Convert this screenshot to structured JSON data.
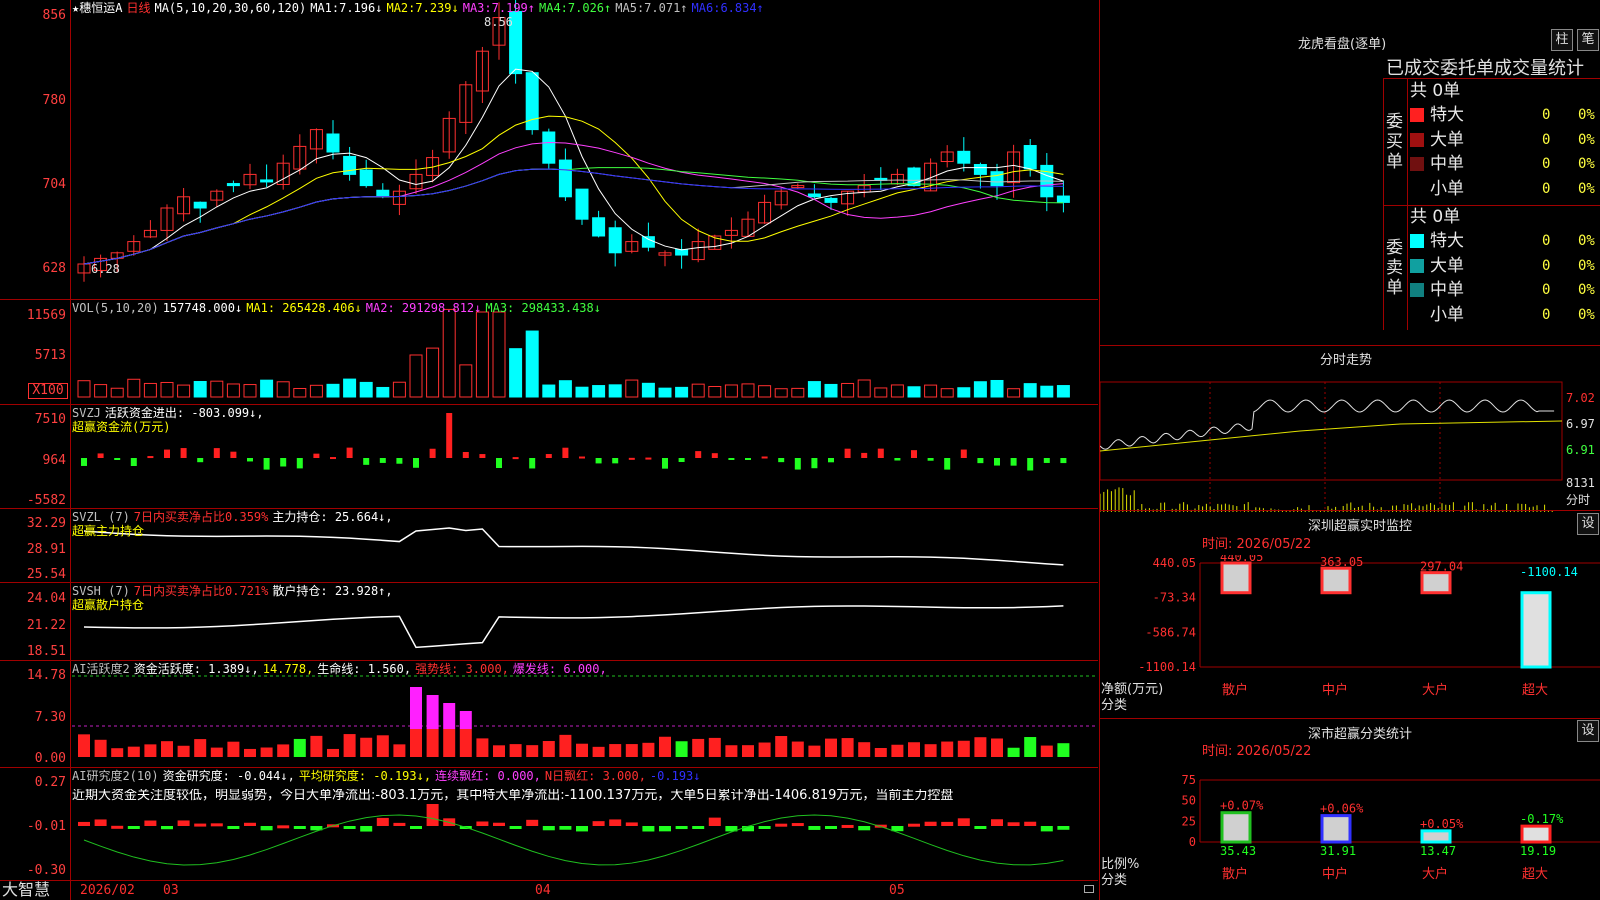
{
  "stock": {
    "star": "★",
    "name": "穗恒运A",
    "period": "日线",
    "ma_params": "MA(5,10,20,30,60,120)"
  },
  "ma_values": [
    {
      "label": "MA1:",
      "val": "7.196↓",
      "color": "#ffffff"
    },
    {
      "label": "MA2:",
      "val": "7.239↓",
      "color": "#ffff00"
    },
    {
      "label": "MA3:",
      "val": "7.199↑",
      "color": "#ff40ff"
    },
    {
      "label": "MA4:",
      "val": "7.026↑",
      "color": "#40ff40"
    },
    {
      "label": "MA5:",
      "val": "7.071↑",
      "color": "#c0c0c0"
    },
    {
      "label": "MA6:",
      "val": "6.834↑",
      "color": "#3030ff"
    }
  ],
  "price_axis": [
    "856",
    "780",
    "704",
    "628"
  ],
  "annotations": {
    "high": "8.56",
    "low": "6.28"
  },
  "vol": {
    "params": "VOL(5,10,20)",
    "value": "157748.000↓",
    "ma1": "MA1: 265428.406↓",
    "ma2": "MA2: 291298.812↓",
    "ma3": "MA3: 298433.438↓",
    "axis": [
      "11569",
      "5713"
    ],
    "unit": "X100"
  },
  "svzj": {
    "name": "SVZJ",
    "line1": "活跃资金进出: -803.099↓,",
    "line2": "超赢资金流(万元)",
    "axis": [
      "7510",
      "964",
      "-5582"
    ]
  },
  "svzl": {
    "name": "SVZL (7)",
    "ratio": "7日内买卖净占比0.359%",
    "hold": "主力持仓: 25.664↓,",
    "line2": "超赢主力持仓",
    "axis": [
      "32.29",
      "28.91",
      "25.54"
    ]
  },
  "svsh": {
    "name": "SVSH (7)",
    "ratio": "7日内买卖净占比0.721%",
    "hold": "散户持仓: 23.928↑,",
    "line2": "超赢散户持仓",
    "axis": [
      "24.04",
      "21.22",
      "18.51"
    ]
  },
  "ai1": {
    "name": "AI活跃度2",
    "t1": "资金活跃度: 1.389↓,",
    "t2": "14.778,",
    "t3": "生命线: 1.560,",
    "t4": "强势线: 3.000,",
    "t5": "爆发线: 6.000,",
    "axis": [
      "14.78",
      "7.30",
      "0.00"
    ]
  },
  "ai2": {
    "name": "AI研究度2(10)",
    "t1": "资金研究度: -0.044↓,",
    "t2": "平均研究度: -0.193↓,",
    "t3": "连续飘红: 0.000,",
    "t4": "N日飘红: 3.000,",
    "t5": "-0.193↓",
    "axis": [
      "0.27",
      "-0.01",
      "-0.30"
    ],
    "comment": "近期大资金关注度较低，明显弱势，今日大单净流出:-803.1万元，其中特大单净流出:-1100.137万元，大单5日累计净出-1406.819万元，当前主力控盘"
  },
  "bottom": {
    "brand": "大智慧",
    "dates": [
      "2026/02",
      "03",
      "04",
      "05"
    ]
  },
  "longhu": {
    "title": "龙虎看盘(逐单)",
    "btn1": "柱",
    "btn2": "笔",
    "subtitle": "已成交委托单成交量统计",
    "buy": {
      "side": "委买单",
      "total": "共 0单",
      "rows": [
        {
          "label": "特大",
          "n": "0",
          "p": "0%",
          "color": "#ff2020"
        },
        {
          "label": "大单",
          "n": "0",
          "p": "0%",
          "color": "#a01010"
        },
        {
          "label": "中单",
          "n": "0",
          "p": "0%",
          "color": "#701010"
        },
        {
          "label": "小单",
          "n": "0",
          "p": "0%",
          "color": "#000000"
        }
      ]
    },
    "sell": {
      "side": "委卖单",
      "total": "共 0单",
      "rows": [
        {
          "label": "特大",
          "n": "0",
          "p": "0%",
          "color": "#00ffff"
        },
        {
          "label": "大单",
          "n": "0",
          "p": "0%",
          "color": "#10a0a0"
        },
        {
          "label": "中单",
          "n": "0",
          "p": "0%",
          "color": "#108080"
        },
        {
          "label": "小单",
          "n": "0",
          "p": "0%",
          "color": "#000000"
        }
      ]
    }
  },
  "intraday": {
    "title": "分时走势",
    "prices": [
      "7.02",
      "6.97",
      "6.91"
    ],
    "vol": "8131",
    "vol_label": "分时"
  },
  "monitor": {
    "title": "深圳超赢实时监控",
    "btn": "设",
    "time": "时间: 2026/05/22",
    "axis": [
      "440.05",
      "-73.34",
      "-586.74",
      "-1100.14"
    ],
    "ylabel": "净额(万元)",
    "xlabel": "分类",
    "chart_data": {
      "type": "bar",
      "categories": [
        "散户",
        "中户",
        "大户",
        "超大"
      ],
      "values": [
        440.05,
        363.05,
        297.04,
        -1100.14
      ],
      "ylim": [
        -1100.14,
        440.05
      ]
    }
  },
  "classify": {
    "title": "深市超赢分类统计",
    "btn": "设",
    "time": "时间: 2026/05/22",
    "axis": [
      "75",
      "50",
      "25",
      "0"
    ],
    "ylabel": "比例%",
    "xlabel": "分类",
    "chart_data": {
      "type": "bar",
      "categories": [
        "散户",
        "中户",
        "大户",
        "超大"
      ],
      "values": [
        35.43,
        31.91,
        13.47,
        19.19
      ],
      "changes": [
        "+0.07%",
        "+0.06%",
        "+0.05%",
        "-0.17%"
      ],
      "ylim": [
        0,
        75
      ]
    }
  }
}
